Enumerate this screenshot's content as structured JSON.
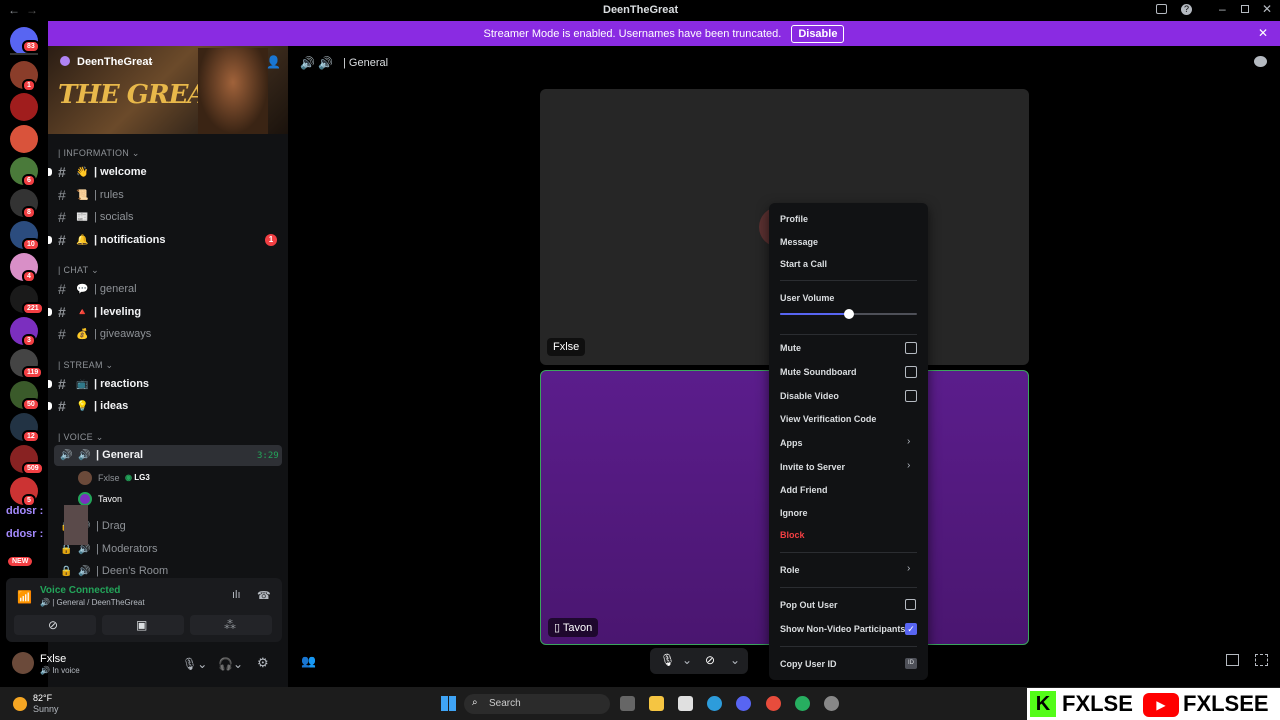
{
  "window": {
    "title": "DeenTheGreat"
  },
  "streamer_bar": {
    "text": "Streamer Mode is enabled. Usernames have been truncated.",
    "button": "Disable"
  },
  "server_badges": [
    "83",
    "1",
    "6",
    "8",
    "10",
    "4",
    "221",
    "3",
    "119",
    "50",
    "12",
    "509",
    "5",
    "NEW"
  ],
  "server": {
    "name": "DeenTheGreat",
    "banner_text": "THE GREATS"
  },
  "categories": {
    "information": "| INFORMATION",
    "chat": "| CHAT",
    "stream": "| STREAM",
    "voice": "| VOICE"
  },
  "channels": [
    {
      "name": "| welcome",
      "emoji": "👋"
    },
    {
      "name": "| rules",
      "emoji": "📜"
    },
    {
      "name": "| socials",
      "emoji": "📰"
    },
    {
      "name": "| notifications",
      "emoji": "🔔",
      "badge": "1"
    },
    {
      "name": "| general",
      "emoji": "💬"
    },
    {
      "name": "| leveling",
      "emoji": "🔺"
    },
    {
      "name": "| giveaways",
      "emoji": "💰"
    },
    {
      "name": "| reactions",
      "emoji": "📺"
    },
    {
      "name": "| ideas",
      "emoji": "💡"
    }
  ],
  "voice_channels": {
    "general": {
      "name": "| General",
      "time": "3:29"
    },
    "members": [
      {
        "name": "Fxlse",
        "tag": "LG3"
      },
      {
        "name": "Tavon"
      }
    ],
    "others": [
      "| Drag",
      "| Moderators",
      "| Deen's Room"
    ]
  },
  "overlay": {
    "line1": "ddosr :",
    "line2": "ddosr :"
  },
  "voice_panel": {
    "status": "Voice Connected",
    "location": "| General / DeenTheGreat"
  },
  "user_panel": {
    "name": "Fxlse",
    "status": "In voice"
  },
  "header": {
    "channel": "| General"
  },
  "tiles": {
    "top_name": "Fxlse",
    "bottom_name": "Tavon"
  },
  "context_menu": {
    "profile": "Profile",
    "message": "Message",
    "start_call": "Start a Call",
    "user_volume": "User Volume",
    "volume_level": 0.5,
    "mute": "Mute",
    "mute_soundboard": "Mute Soundboard",
    "disable_video": "Disable Video",
    "verification": "View Verification Code",
    "apps": "Apps",
    "invite": "Invite to Server",
    "add_friend": "Add Friend",
    "ignore": "Ignore",
    "block": "Block",
    "role": "Role",
    "pop_out": "Pop Out User",
    "show_non_video": "Show Non-Video Participants",
    "copy_id": "Copy User ID"
  },
  "taskbar": {
    "weather_temp": "82°F",
    "weather_desc": "Sunny",
    "search": "Search"
  },
  "watermark": {
    "left": "FXLSE",
    "right": "FXLSEE"
  },
  "colors": {
    "accent": "#8a2be2",
    "danger": "#f23f43",
    "connected": "#23a55a"
  }
}
